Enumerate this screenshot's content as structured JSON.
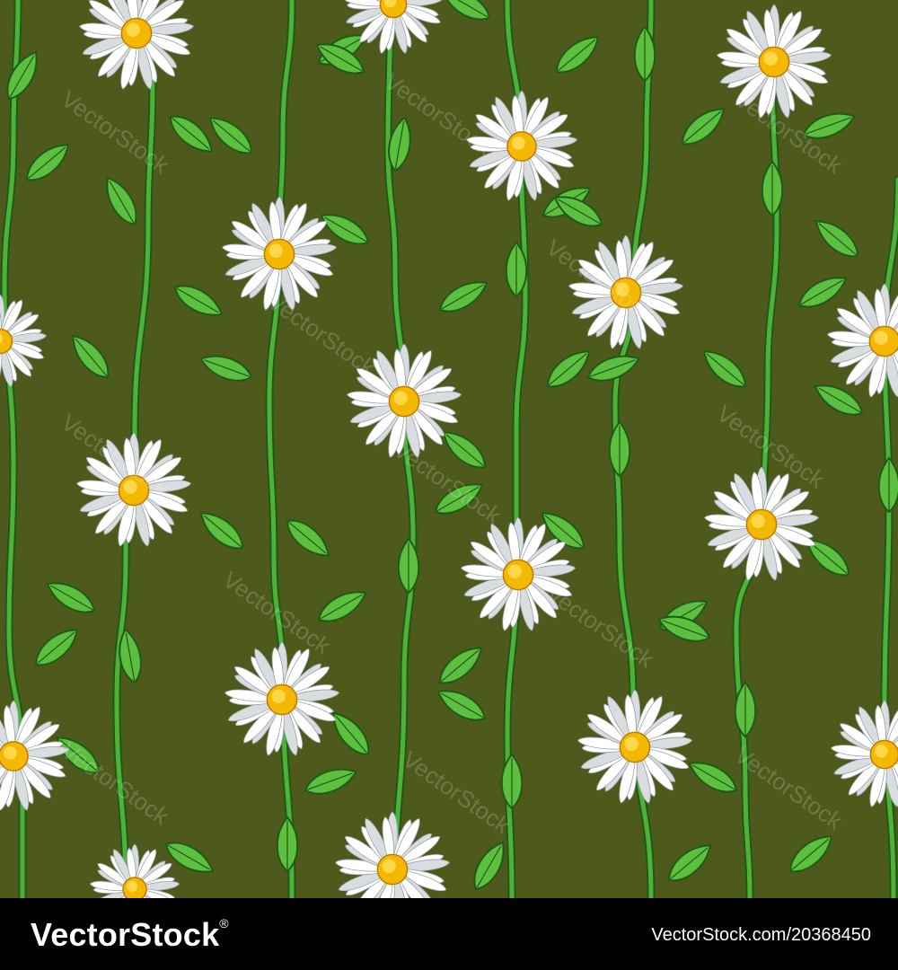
{
  "image": {
    "kind": "seamless floral pattern",
    "subject": "white daisies on tall green stems with serrated leaves",
    "background_color": "#4d5a1c",
    "petal_color": "#ffffff",
    "petal_shade_color": "#d9dde0",
    "center_color": "#f5b800",
    "stem_color": "#4fb03a",
    "stem_outline_color": "#1f5a14",
    "leaf_color": "#5cbf3f"
  },
  "watermark": {
    "text": "VectorStock",
    "icon": "registered-mark"
  },
  "footer": {
    "logo_text": "VectorStock",
    "logo_mark": "®",
    "credit": "VectorStock.com/20368450"
  }
}
